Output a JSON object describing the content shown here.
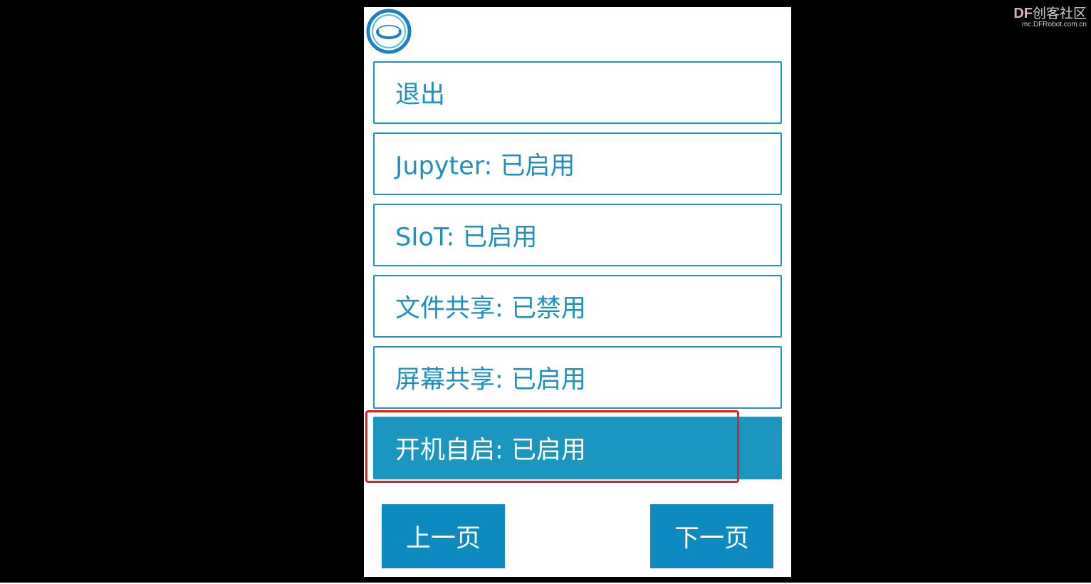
{
  "watermark": {
    "brand": "DF",
    "name": "创客社区",
    "url": "mc.DFRobot.com.cn"
  },
  "screen": {
    "logo_icon": "loop-ring-logo-icon",
    "menu_items": [
      {
        "label": "退出"
      },
      {
        "label": "Jupyter: 已启用"
      },
      {
        "label": "SIoT: 已启用"
      },
      {
        "label": "文件共享: 已禁用"
      },
      {
        "label": "屏幕共享: 已启用"
      },
      {
        "label": "开机自启: 已启用"
      }
    ],
    "selected_index": 5,
    "prev_label": "上一页",
    "next_label": "下一页"
  },
  "colors": {
    "accent": "#1a96c0",
    "border": "#1f95c2",
    "button": "#0d8ac0",
    "highlight": "#e02020",
    "background": "#000000"
  }
}
